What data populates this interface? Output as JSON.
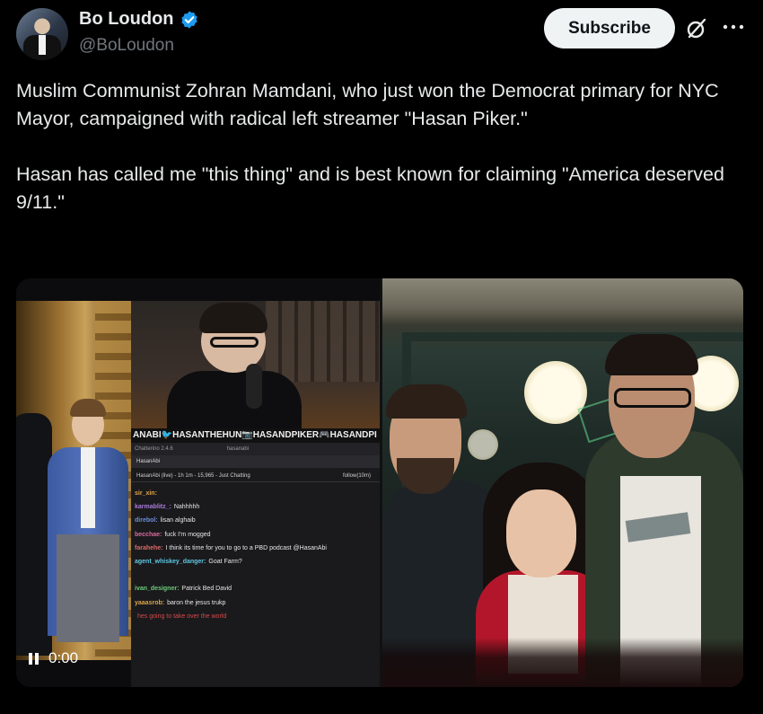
{
  "author": {
    "name": "Bo Loudon",
    "handle": "@BoLoudon"
  },
  "actions": {
    "subscribe_label": "Subscribe",
    "grok_icon": "grok-icon",
    "more_icon": "more-icon"
  },
  "tweet": {
    "text": "Muslim Communist Zohran Mamdani, who just won the Democrat primary for NYC Mayor, campaigned with radical left streamer \"Hasan Piker.\"\n\nHasan has called me \"this thing\" and is best known for claiming \"America deserved 9/11.\""
  },
  "media": {
    "video": {
      "timecode": "0:00",
      "stream_banner": "ANABI🐦HASANTHEHUN📷HASANDPIKER🎮HASANDPI",
      "chat_app": "Chatterino 2.4.6",
      "chat_user": "hasanabi",
      "chat_tab": "HasanAbi",
      "chat_status": "HasanAbi (live) - 1h 1m - 15,965 - Just Chatting",
      "chat_follow": "follow(10m)",
      "chat_lines": [
        {
          "user": "sir_xin:",
          "msg": "",
          "color": "#e3a64d"
        },
        {
          "user": "karmablitz_:",
          "msg": "Nahhhhh",
          "color": "#a87ad9"
        },
        {
          "user": "direbol:",
          "msg": "lisan alghaib",
          "color": "#6d8cd9"
        },
        {
          "user": "becchae:",
          "msg": "fuck I'm mogged",
          "color": "#d86a9c"
        },
        {
          "user": "farahehe:",
          "msg": "I think its time for you to go to a PBD podcast @HasanAbi",
          "color": "#d96a6a"
        },
        {
          "user": "agent_whiskey_danger:",
          "msg": "Goat Farm?",
          "color": "#5fc7e0"
        },
        {
          "user": "",
          "msg": "",
          "color": "#d94848"
        },
        {
          "user": "ivan_designer:",
          "msg": "Patrick Bed David",
          "color": "#6ec97a"
        },
        {
          "user": "yaaasrob:",
          "msg": "baron the jesus trukp",
          "color": "#d9a54a"
        },
        {
          "user": "",
          "msg": "hes going to take over the world",
          "color": "#d94848"
        }
      ]
    }
  },
  "colors": {
    "background": "#000000",
    "text_primary": "#e7e9ea",
    "text_secondary": "#71767b",
    "verified": "#1d9bf0",
    "subscribe_bg": "#eff3f4"
  }
}
